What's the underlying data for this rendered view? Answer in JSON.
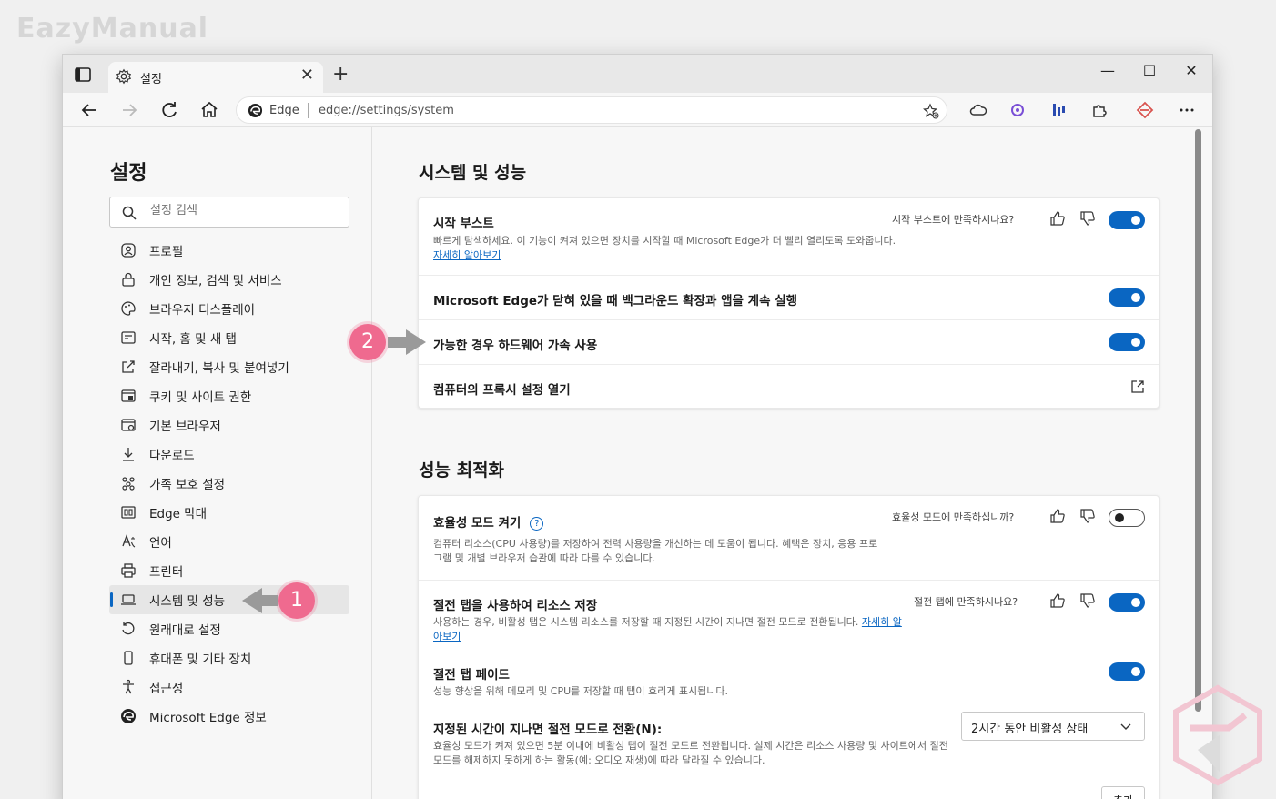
{
  "watermark": "EazyManual",
  "tab": {
    "title": "설정",
    "close": "✕",
    "new": "+"
  },
  "window_controls": {
    "minimize": "—",
    "maximize": "☐",
    "close": "✕"
  },
  "address": {
    "site": "Edge",
    "url": "edge://settings/system"
  },
  "sidebar": {
    "heading": "설정",
    "search_placeholder": "설정 검색",
    "items": [
      {
        "label": "프로필",
        "icon": "profile-icon"
      },
      {
        "label": "개인 정보, 검색 및 서비스",
        "icon": "lock-icon"
      },
      {
        "label": "브라우저 디스플레이",
        "icon": "palette-icon"
      },
      {
        "label": "시작, 홈 및 새 탭",
        "icon": "start-icon"
      },
      {
        "label": "잘라내기, 복사 및 붙여넣기",
        "icon": "share-icon"
      },
      {
        "label": "쿠키 및 사이트 권한",
        "icon": "cookie-icon"
      },
      {
        "label": "기본 브라우저",
        "icon": "browser-icon"
      },
      {
        "label": "다운로드",
        "icon": "download-icon"
      },
      {
        "label": "가족 보호 설정",
        "icon": "family-icon"
      },
      {
        "label": "Edge 막대",
        "icon": "edgebar-icon"
      },
      {
        "label": "언어",
        "icon": "language-icon"
      },
      {
        "label": "프린터",
        "icon": "printer-icon"
      },
      {
        "label": "시스템 및 성능",
        "icon": "laptop-icon",
        "active": true
      },
      {
        "label": "원래대로 설정",
        "icon": "reset-icon"
      },
      {
        "label": "휴대폰 및 기타 장치",
        "icon": "phone-icon"
      },
      {
        "label": "접근성",
        "icon": "accessibility-icon"
      },
      {
        "label": "Microsoft Edge 정보",
        "icon": "edge-icon"
      }
    ]
  },
  "system": {
    "title": "시스템 및 성능",
    "startup_boost": {
      "title": "시작 부스트",
      "desc": "빠르게 탐색하세요. 이 기능이 켜져 있으면 장치를 시작할 때 Microsoft Edge가 더 빨리 열리도록 도와줍니다.",
      "link": "자세히 알아보기",
      "feedback": "시작 부스트에 만족하시나요?",
      "enabled": true
    },
    "background": {
      "title": "Microsoft Edge가 닫혀 있을 때 백그라운드 확장과 앱을 계속 실행",
      "enabled": true
    },
    "hardware": {
      "title": "가능한 경우 하드웨어 가속 사용",
      "enabled": true
    },
    "proxy": {
      "title": "컴퓨터의 프록시 설정 열기"
    }
  },
  "performance": {
    "title": "성능 최적화",
    "efficiency": {
      "title": "효율성 모드 켜기",
      "help": "?",
      "desc": "컴퓨터 리소스(CPU 사용량)를 저장하여 전력 사용량을 개선하는 데 도움이 됩니다. 혜택은 장치, 응용 프로그램 및 개별 브라우저 습관에 따라 다를 수 있습니다.",
      "feedback": "효율성 모드에 만족하십니까?",
      "enabled": false
    },
    "sleeping_tabs": {
      "title": "절전 탭을 사용하여 리소스 저장",
      "desc": "사용하는 경우, 비활성 탭은 시스템 리소스를 저장할 때 지정된 시간이 지나면 절전 모드로 전환됩니다.",
      "link": "자세히 알아보기",
      "feedback": "절전 탭에 만족하시나요?",
      "enabled": true
    },
    "fade": {
      "title": "절전 탭 페이드",
      "desc": "성능 향상을 위해 메모리 및 CPU를 저장할 때 탭이 흐리게 표시됩니다.",
      "enabled": true
    },
    "timeout": {
      "title": "지정된 시간이 지나면 절전 모드로 전환(N):",
      "desc": "효율성 모드가 켜져 있으면 5분 이내에 비활성 탭이 절전 모드로 전환됩니다. 실제 시간은 리소스 사용량 및 사이트에서 절전 모드를 해제하지 못하게 하는 활동(예: 오디오 재생)에 따라 달라질 수 있습니다.",
      "value": "2시간 동안 비활성 상태"
    },
    "add_button": "추가"
  },
  "annotations": {
    "one": "1",
    "two": "2"
  },
  "colors": {
    "accent": "#0a66c2",
    "badge": "#ef6a8f"
  }
}
